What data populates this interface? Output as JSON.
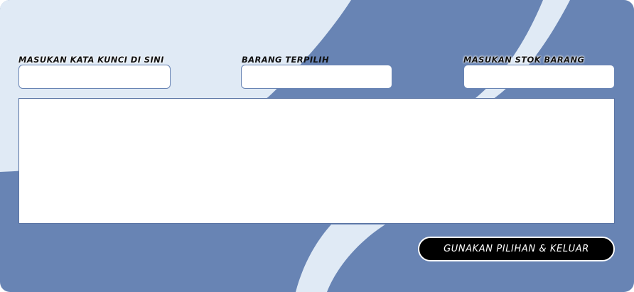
{
  "form": {
    "keyword": {
      "label": "MASUKAN KATA KUNCI DI SINI",
      "value": "",
      "placeholder": ""
    },
    "selected_item": {
      "label": "BARANG TERPILIH",
      "value": "",
      "placeholder": ""
    },
    "stock": {
      "label": "MASUKAN STOK BARANG",
      "value": "",
      "placeholder": ""
    }
  },
  "results": {
    "items": []
  },
  "actions": {
    "apply_label": "GUNAKAN PILIHAN & KELUAR"
  },
  "colors": {
    "background": "#6884b4",
    "accent_light": "#e0eaf5",
    "button": "#000000",
    "button_text": "#ffffff"
  }
}
